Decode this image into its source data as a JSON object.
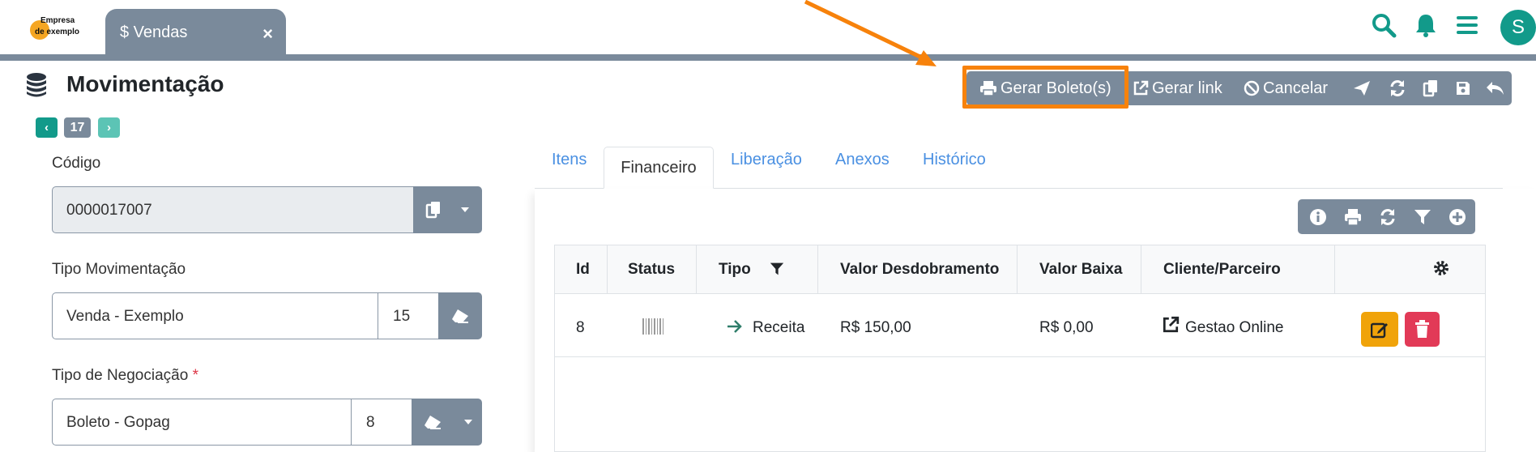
{
  "brand": {
    "name_line1": "Empresa",
    "name_line2": "de exemplo",
    "accent": "#129a8a"
  },
  "open_tab": {
    "icon": "dollar-icon",
    "label": "$ Vendas",
    "close": "×"
  },
  "header_icons": [
    "search-icon",
    "bell-icon",
    "menu-icon"
  ],
  "user": {
    "initial": "S"
  },
  "page": {
    "title": "Movimentação",
    "record_number": "17"
  },
  "toolbar": {
    "gerar_boleto": "Gerar Boleto(s)",
    "gerar_link": "Gerar link",
    "cancelar": "Cancelar",
    "icons": [
      "send-icon",
      "refresh-icon",
      "copy-icon",
      "save-icon",
      "undo-icon"
    ]
  },
  "form": {
    "codigo": {
      "label": "Código",
      "value": "0000017007"
    },
    "tipo_movimentacao": {
      "label": "Tipo Movimentação",
      "value": "Venda - Exemplo",
      "code": "15"
    },
    "tipo_negociacao": {
      "label": "Tipo de Negociação",
      "required_mark": "*",
      "value": "Boleto - Gopag",
      "code": "8"
    }
  },
  "tabs": [
    "Itens",
    "Financeiro",
    "Liberação",
    "Anexos",
    "Histórico"
  ],
  "active_tab": "Financeiro",
  "grid_tools": [
    "info-icon",
    "print-icon",
    "refresh-icon",
    "filter-icon",
    "add-icon"
  ],
  "table": {
    "headers": [
      "Id",
      "Status",
      "Tipo",
      "Valor Desdobramento",
      "Valor Baixa",
      "Cliente/Parceiro"
    ],
    "rows": [
      {
        "id": "8",
        "status": "barcode-icon",
        "tipo": "Receita",
        "valor_desdobramento": "R$ 150,00",
        "valor_baixa": "R$ 0,00",
        "cliente": "Gestao Online"
      }
    ]
  },
  "colors": {
    "toolbar": "#7a8a9b",
    "highlight": "#f7820b",
    "edit": "#f0a30a",
    "delete": "#e23a57",
    "link": "#4a90e2"
  }
}
